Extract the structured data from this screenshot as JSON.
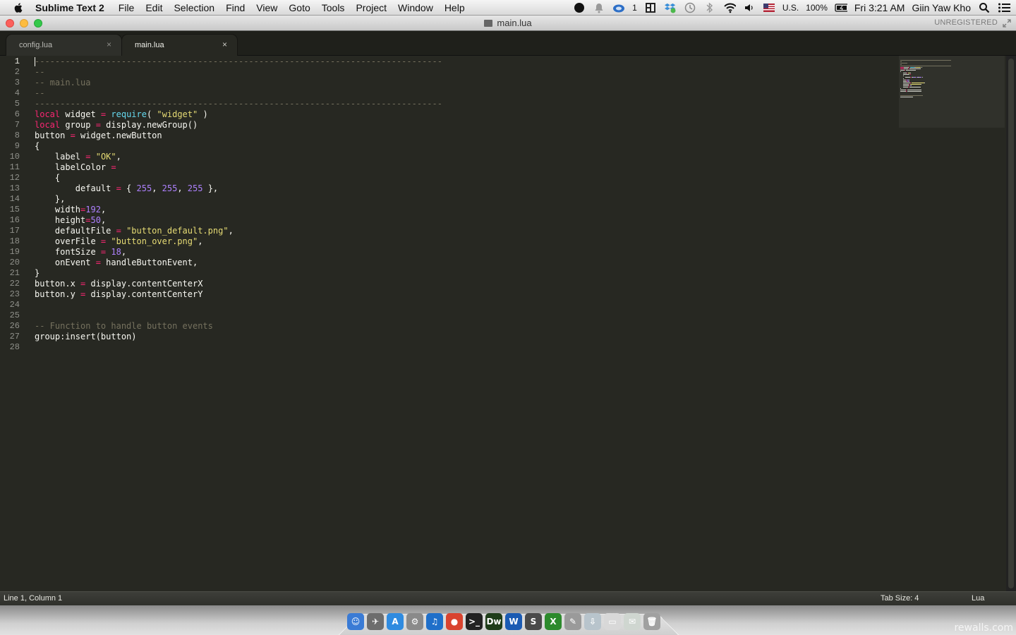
{
  "menubar": {
    "app_name": "Sublime Text 2",
    "menus": [
      "File",
      "Edit",
      "Selection",
      "Find",
      "View",
      "Goto",
      "Tools",
      "Project",
      "Window",
      "Help"
    ],
    "status_count": "1",
    "keyboard": "U.S.",
    "battery": "100%",
    "clock": "Fri 3:21 AM",
    "user": "Giin Yaw Kho"
  },
  "window": {
    "title": "main.lua",
    "registration": "UNREGISTERED"
  },
  "tabs": [
    {
      "label": "config.lua",
      "close": "×",
      "active": false
    },
    {
      "label": "main.lua",
      "close": "×",
      "active": true
    }
  ],
  "editor": {
    "active_line": 1,
    "lines": [
      [
        {
          "t": "c",
          "v": "--------------------------------------------------------------------------------"
        }
      ],
      [
        {
          "t": "c",
          "v": "--"
        }
      ],
      [
        {
          "t": "c",
          "v": "-- main.lua"
        }
      ],
      [
        {
          "t": "c",
          "v": "--"
        }
      ],
      [
        {
          "t": "c",
          "v": "--------------------------------------------------------------------------------"
        }
      ],
      [
        {
          "t": "k",
          "v": "local"
        },
        {
          "t": "p",
          "v": " widget "
        },
        {
          "t": "o",
          "v": "="
        },
        {
          "t": "p",
          "v": " "
        },
        {
          "t": "b",
          "v": "require"
        },
        {
          "t": "p",
          "v": "( "
        },
        {
          "t": "s",
          "v": "\"widget\""
        },
        {
          "t": "p",
          "v": " )"
        }
      ],
      [
        {
          "t": "k",
          "v": "local"
        },
        {
          "t": "p",
          "v": " group "
        },
        {
          "t": "o",
          "v": "="
        },
        {
          "t": "p",
          "v": " display.newGroup()"
        }
      ],
      [
        {
          "t": "p",
          "v": "button "
        },
        {
          "t": "o",
          "v": "="
        },
        {
          "t": "p",
          "v": " widget.newButton"
        }
      ],
      [
        {
          "t": "p",
          "v": "{"
        }
      ],
      [
        {
          "t": "p",
          "v": "    label "
        },
        {
          "t": "o",
          "v": "="
        },
        {
          "t": "p",
          "v": " "
        },
        {
          "t": "s",
          "v": "\"OK\""
        },
        {
          "t": "p",
          "v": ","
        }
      ],
      [
        {
          "t": "p",
          "v": "    labelColor "
        },
        {
          "t": "o",
          "v": "="
        }
      ],
      [
        {
          "t": "p",
          "v": "    {"
        }
      ],
      [
        {
          "t": "p",
          "v": "        default "
        },
        {
          "t": "o",
          "v": "="
        },
        {
          "t": "p",
          "v": " { "
        },
        {
          "t": "n",
          "v": "255"
        },
        {
          "t": "p",
          "v": ", "
        },
        {
          "t": "n",
          "v": "255"
        },
        {
          "t": "p",
          "v": ", "
        },
        {
          "t": "n",
          "v": "255"
        },
        {
          "t": "p",
          "v": " },"
        }
      ],
      [
        {
          "t": "p",
          "v": "    },"
        }
      ],
      [
        {
          "t": "p",
          "v": "    width"
        },
        {
          "t": "o",
          "v": "="
        },
        {
          "t": "n",
          "v": "192"
        },
        {
          "t": "p",
          "v": ","
        }
      ],
      [
        {
          "t": "p",
          "v": "    height"
        },
        {
          "t": "o",
          "v": "="
        },
        {
          "t": "n",
          "v": "50"
        },
        {
          "t": "p",
          "v": ","
        }
      ],
      [
        {
          "t": "p",
          "v": "    defaultFile "
        },
        {
          "t": "o",
          "v": "="
        },
        {
          "t": "p",
          "v": " "
        },
        {
          "t": "s",
          "v": "\"button_default.png\""
        },
        {
          "t": "p",
          "v": ","
        }
      ],
      [
        {
          "t": "p",
          "v": "    overFile "
        },
        {
          "t": "o",
          "v": "="
        },
        {
          "t": "p",
          "v": " "
        },
        {
          "t": "s",
          "v": "\"button_over.png\""
        },
        {
          "t": "p",
          "v": ","
        }
      ],
      [
        {
          "t": "p",
          "v": "    fontSize "
        },
        {
          "t": "o",
          "v": "="
        },
        {
          "t": "p",
          "v": " "
        },
        {
          "t": "n",
          "v": "18"
        },
        {
          "t": "p",
          "v": ","
        }
      ],
      [
        {
          "t": "p",
          "v": "    onEvent "
        },
        {
          "t": "o",
          "v": "="
        },
        {
          "t": "p",
          "v": " handleButtonEvent,"
        }
      ],
      [
        {
          "t": "p",
          "v": "}"
        }
      ],
      [
        {
          "t": "p",
          "v": "button.x "
        },
        {
          "t": "o",
          "v": "="
        },
        {
          "t": "p",
          "v": " display.contentCenterX"
        }
      ],
      [
        {
          "t": "p",
          "v": "button.y "
        },
        {
          "t": "o",
          "v": "="
        },
        {
          "t": "p",
          "v": " display.contentCenterY"
        }
      ],
      [],
      [],
      [
        {
          "t": "c",
          "v": "-- Function to handle button events"
        }
      ],
      [
        {
          "t": "p",
          "v": "group:insert(button)"
        }
      ],
      []
    ]
  },
  "statusbar": {
    "position": "Line 1, Column 1",
    "tab_size": "Tab Size: 4",
    "syntax": "Lua"
  },
  "dock": {
    "apps": [
      {
        "name": "finder-icon",
        "color": "#3a7bd5",
        "glyph": "☺"
      },
      {
        "name": "launchpad-icon",
        "color": "#6d6d6d",
        "glyph": "✈"
      },
      {
        "name": "app-store-icon",
        "color": "#2f8be0",
        "glyph": "A"
      },
      {
        "name": "system-preferences-icon",
        "color": "#8a8a8a",
        "glyph": "⚙"
      },
      {
        "name": "itunes-icon",
        "color": "#1f6fc9",
        "glyph": "♫"
      },
      {
        "name": "chrome-icon",
        "color": "#d9432f",
        "glyph": "●"
      },
      {
        "name": "terminal-icon",
        "color": "#222222",
        "glyph": ">_"
      },
      {
        "name": "dreamweaver-icon",
        "color": "#1f3d1a",
        "glyph": "Dw"
      },
      {
        "name": "word-icon",
        "color": "#1b5bb3",
        "glyph": "W"
      },
      {
        "name": "sublime-text-icon",
        "color": "#4a4a4a",
        "glyph": "S"
      },
      {
        "name": "excel-icon",
        "color": "#2c8a2c",
        "glyph": "X"
      },
      {
        "name": "preview-icon",
        "color": "#9a9a9a",
        "glyph": "✎"
      },
      {
        "name": "downloads-stack-icon",
        "color": "#b8c4cc",
        "glyph": "⇩"
      },
      {
        "name": "documents-stack-icon",
        "color": "#d8d8d8",
        "glyph": "▭"
      },
      {
        "name": "mail-stack-icon",
        "color": "#cfd6d0",
        "glyph": "✉"
      },
      {
        "name": "trash-icon",
        "color": "#a0a0a0",
        "glyph": "🗑"
      }
    ]
  },
  "watermark": "rewalls.com",
  "colors": {
    "editor_bg": "#272822",
    "comment": "#75715e",
    "keyword": "#f92672",
    "builtin": "#66d9ef",
    "string": "#e6db74",
    "number": "#ae81ff",
    "foreground": "#f8f8f2"
  }
}
